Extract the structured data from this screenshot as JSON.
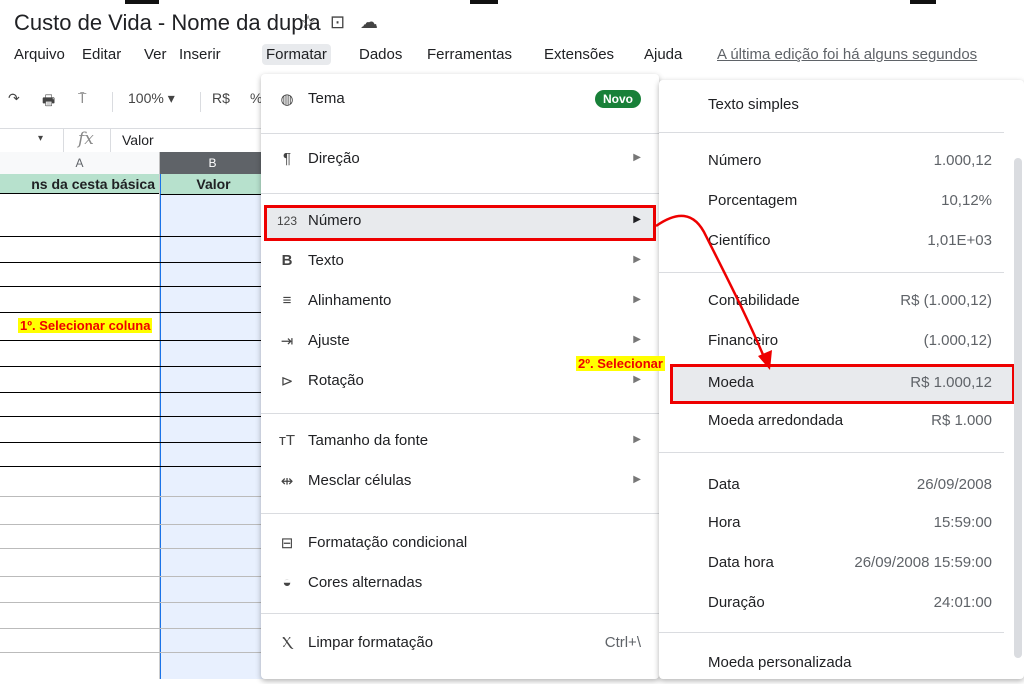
{
  "doc": {
    "title": "Custo de Vida - Nome da dupla"
  },
  "icons": {
    "star": "star-icon",
    "move": "move-to-folder-icon",
    "cloud": "cloud-status-icon"
  },
  "menubar": {
    "items": [
      "Arquivo",
      "Editar",
      "Ver",
      "Inserir",
      "Formatar",
      "Dados",
      "Ferramentas",
      "Extensões",
      "Ajuda"
    ],
    "active": "Formatar",
    "last_edit": "A última edição foi há alguns segundos"
  },
  "toolbar": {
    "zoom": "100%",
    "currency": "R$",
    "percent": "%"
  },
  "formula_bar": {
    "fx": "fx",
    "value": "Valor"
  },
  "grid": {
    "col_a": "A",
    "col_b": "B",
    "header_a": "ns da cesta básica",
    "header_b": "Valor"
  },
  "callouts": {
    "step1": "1º. Selecionar coluna",
    "step2": "2º. Selecionar"
  },
  "format_menu": {
    "items": [
      {
        "label": "Tema",
        "badge": "Novo"
      },
      {
        "label": "Direção"
      },
      {
        "label": "Número"
      },
      {
        "label": "Texto"
      },
      {
        "label": "Alinhamento"
      },
      {
        "label": "Ajuste"
      },
      {
        "label": "Rotação"
      },
      {
        "label": "Tamanho da fonte"
      },
      {
        "label": "Mesclar células"
      },
      {
        "label": "Formatação condicional"
      },
      {
        "label": "Cores alternadas"
      },
      {
        "label": "Limpar formatação",
        "shortcut": "Ctrl+\\"
      }
    ]
  },
  "number_menu": {
    "items": [
      {
        "label": "Texto simples",
        "value": ""
      },
      {
        "label": "Número",
        "value": "1.000,12"
      },
      {
        "label": "Porcentagem",
        "value": "10,12%"
      },
      {
        "label": "Científico",
        "value": "1,01E+03"
      },
      {
        "label": "Contabilidade",
        "value": "R$ (1.000,12)"
      },
      {
        "label": "Financeiro",
        "value": "(1.000,12)"
      },
      {
        "label": "Moeda",
        "value": "R$ 1.000,12"
      },
      {
        "label": "Moeda arredondada",
        "value": "R$ 1.000"
      },
      {
        "label": "Data",
        "value": "26/09/2008"
      },
      {
        "label": "Hora",
        "value": "15:59:00"
      },
      {
        "label": "Data hora",
        "value": "26/09/2008 15:59:00"
      },
      {
        "label": "Duração",
        "value": "24:01:00"
      },
      {
        "label": "Moeda personalizada",
        "value": ""
      }
    ]
  }
}
